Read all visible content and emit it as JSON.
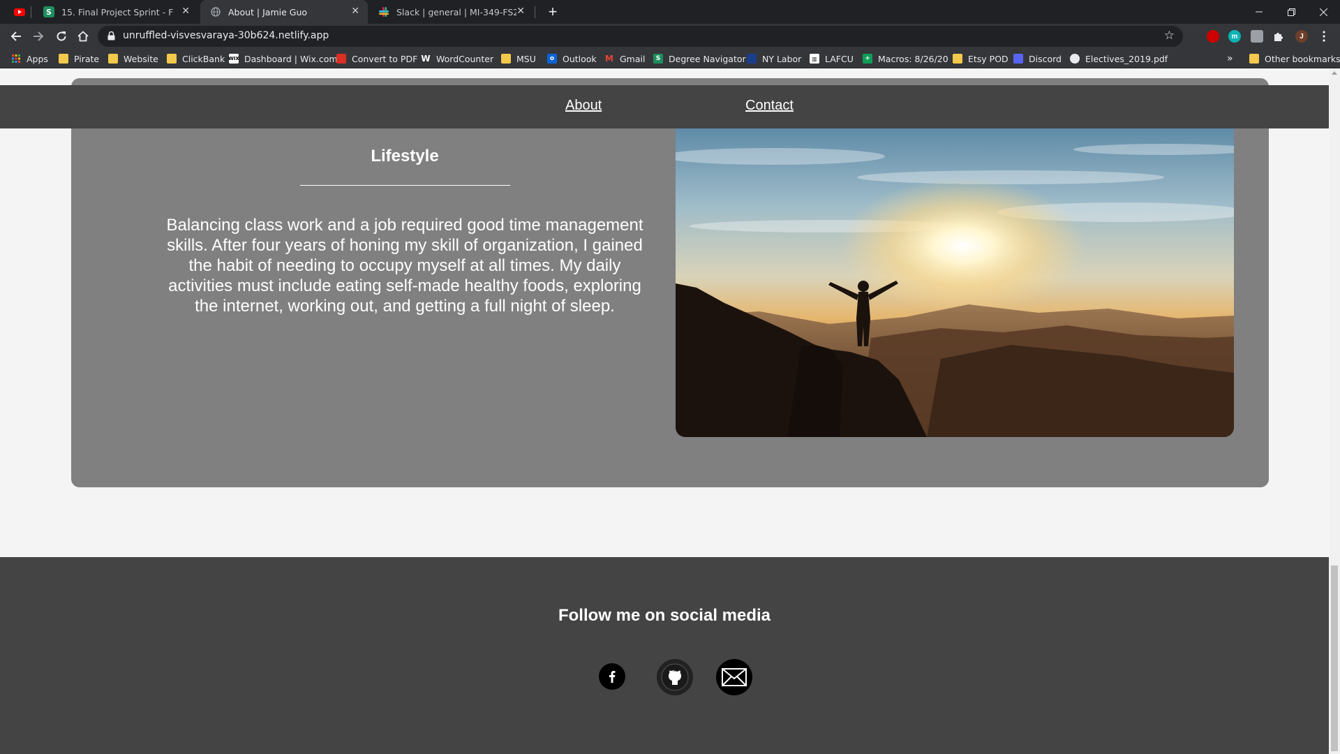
{
  "browser": {
    "tabs": [
      {
        "title": "15. Final Project Sprint - FS20-MI",
        "active": false
      },
      {
        "title": "About | Jamie Guo",
        "active": true
      },
      {
        "title": "Slack | general | MI-349-FS20 | 1",
        "active": false
      }
    ],
    "new_tab": "+",
    "url": "unruffled-visvesvaraya-30b624.netlify.app",
    "profile_initial": "J",
    "bookmarks": [
      {
        "label": "Apps",
        "icon": "apps-grid-icon"
      },
      {
        "label": "Pirate",
        "icon": "folder-icon"
      },
      {
        "label": "Website",
        "icon": "folder-icon"
      },
      {
        "label": "ClickBank",
        "icon": "folder-icon"
      },
      {
        "label": "Dashboard | Wix.com",
        "icon": "wix-icon"
      },
      {
        "label": "Convert to PDF",
        "icon": "pdf-icon"
      },
      {
        "label": "WordCounter",
        "icon": "w-icon"
      },
      {
        "label": "MSU",
        "icon": "folder-icon"
      },
      {
        "label": "Outlook",
        "icon": "outlook-icon"
      },
      {
        "label": "Gmail",
        "icon": "gmail-icon"
      },
      {
        "label": "Degree Navigator",
        "icon": "degree-navigator-icon"
      },
      {
        "label": "NY Labor",
        "icon": "ny-labor-icon"
      },
      {
        "label": "LAFCU",
        "icon": "bank-icon"
      },
      {
        "label": "Macros: 8/26/20",
        "icon": "sheets-icon"
      },
      {
        "label": "Etsy POD",
        "icon": "folder-icon"
      },
      {
        "label": "Discord",
        "icon": "discord-icon"
      },
      {
        "label": "Electives_2019.pdf",
        "icon": "globe-icon"
      }
    ],
    "more_bookmarks": "»",
    "other_bookmarks": "Other bookmarks"
  },
  "page": {
    "nav": {
      "about": "About",
      "contact": "Contact"
    },
    "section": {
      "title": "Lifestyle",
      "body": "Balancing class work and a job required good time management skills. After four years of honing my skill of organization, I gained the habit of needing to occupy myself at all times. My daily activities must include eating self-made healthy foods, exploring the internet, working out, and getting a full night of sleep."
    },
    "footer": {
      "title": "Follow me on social media",
      "links": [
        "facebook-icon",
        "github-icon",
        "email-icon"
      ]
    }
  },
  "colors": {
    "card": "#808080",
    "navbar": "#444444",
    "footer": "#444444",
    "page_bg": "#f4f4f4"
  }
}
